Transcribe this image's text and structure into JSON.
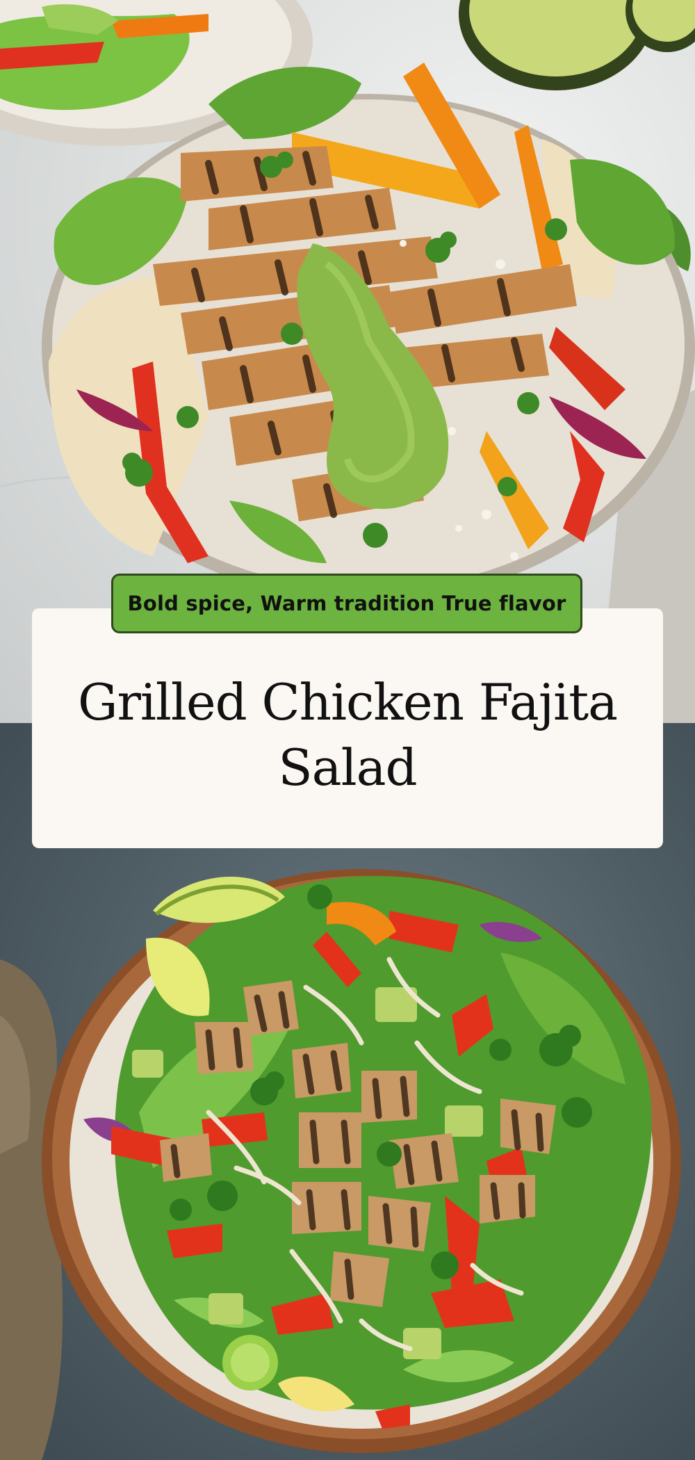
{
  "tagline": "Bold spice, Warm tradition True flavor",
  "title": "Grilled Chicken Fajita Salad",
  "photos": {
    "top": "grilled-chicken-fajita-plate",
    "bottom": "chopped-chicken-salad-bowl"
  }
}
